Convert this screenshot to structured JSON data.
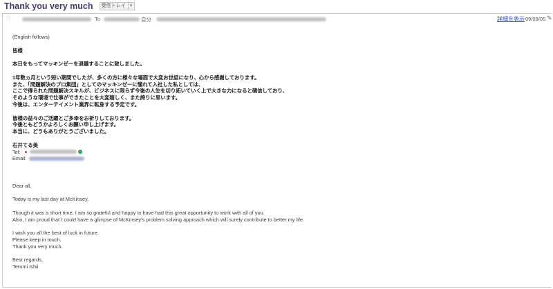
{
  "message": {
    "subject": "Thank you very much",
    "label_chip": "受信トレイ",
    "label_chip_close": "×",
    "star": "☆",
    "to_label": "To",
    "me_label": "自分",
    "details_link": "詳細を表示",
    "date": "09/08/05",
    "pencil": "✎"
  },
  "body": {
    "english_follows": "(English follows)",
    "jp": {
      "greeting": "皆様",
      "retire": "本日をもってマッキンゼーを退職することに致しました。",
      "p1_l1": "1年数ヵ月という短い期間でしたが、多くの方に様々な場面で大変お世話になり、心から感謝しております。",
      "p1_l2": "また、「問題解決のプロ集団」としてのマッキンゼーに憧れて入社した私としては、",
      "p1_l3": "ここで得られた問題解決スキルが、ビジネスに限らず今後の人生を切り拓いていく上で大きな力になると確信しており、",
      "p1_l4": "そのような環境で仕事ができたことを大変嬉しく、また誇りに思います。",
      "p1_l5": "今後は、エンターテイメント業界に転身する予定です。",
      "p2_l1": "皆様の益々のご活躍とご多幸をお祈りしております。",
      "p2_l2": "今後ともどうかよろしくお願い申し上げます。",
      "p2_l3": "本当に、どうもありがとうございました。",
      "sign_name": "石井てる美",
      "tel_label": "Tel:",
      "email_label": "Email:"
    },
    "en": {
      "greeting": "Dear all,",
      "last_day": "Today is my last day at McKinsey.",
      "p1_l1": "Though it was a short time, I am so grateful and happy to have had this great opportunity to work with all of you.",
      "p1_l2": "Also, I am proud that I could have a glimpse of McKinsey's problem solving approach which will surely contribute to better my life.",
      "p2_l1": "I wish you all the best of luck in future.",
      "p2_l2": "Please keep in touch.",
      "p2_l3": "Thank you very much.",
      "closing": "Best regards,",
      "name": "Terumi Ishii"
    }
  }
}
